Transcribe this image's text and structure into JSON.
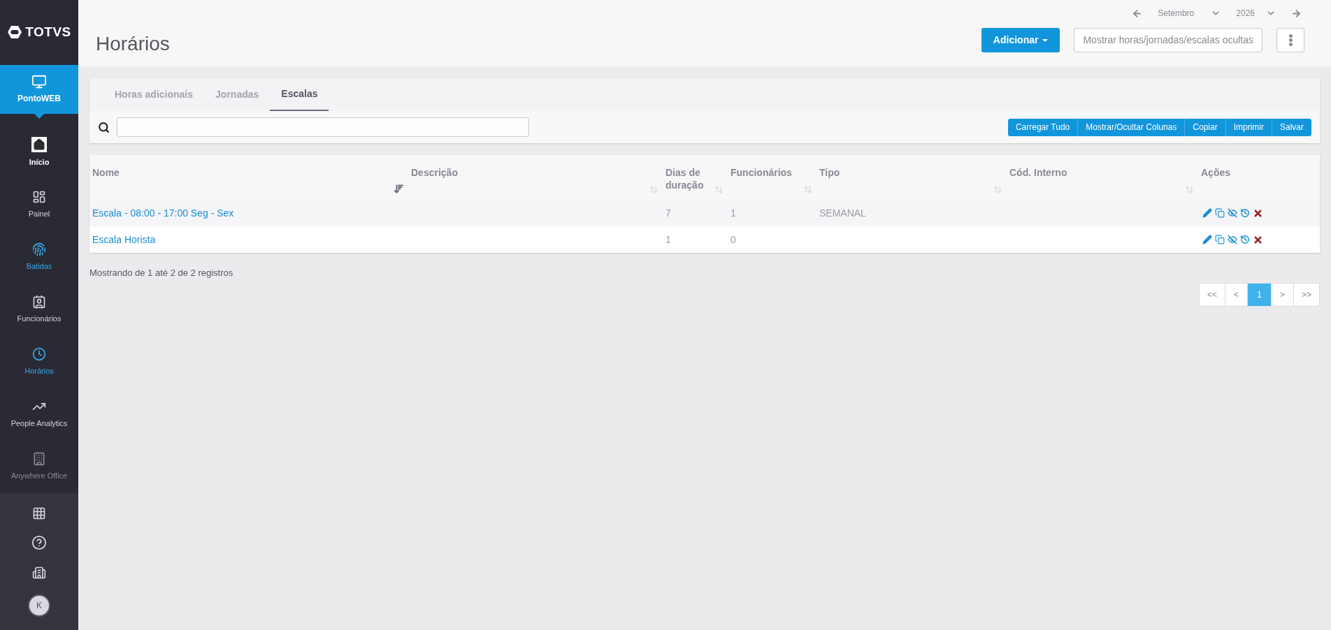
{
  "sidebar": {
    "logo": "TOTVS",
    "product": "PontoWEB",
    "items": [
      {
        "label": "Início",
        "selected": true,
        "color": "#ffffff"
      },
      {
        "label": "Painel",
        "selected": false,
        "color": "#d4d4dc"
      },
      {
        "label": "Batidas",
        "selected": false,
        "color": "#3ba7e8"
      },
      {
        "label": "Funcionários",
        "selected": false,
        "color": "#d4d4dc"
      },
      {
        "label": "Horários",
        "selected": false,
        "color": "#3ba7e8"
      },
      {
        "label": "People Analytics",
        "selected": false,
        "color": "#d4d4dc"
      },
      {
        "label": "Anywhere Office",
        "selected": false,
        "color": "#8a8a96"
      }
    ],
    "avatar": "K"
  },
  "header": {
    "title": "Horários",
    "month": "Setembro",
    "year": "2026",
    "add_button": "Adicionar",
    "toggle_button": "Mostrar horas/jornadas/escalas ocultas"
  },
  "tabs": [
    {
      "label": "Horas adicionais",
      "selected": false
    },
    {
      "label": "Jornadas",
      "selected": false
    },
    {
      "label": "Escalas",
      "selected": true
    }
  ],
  "toolbar": {
    "buttons": [
      "Carregar Tudo",
      "Mostrar/Ocultar Colunas",
      "Copiar",
      "Imprimir",
      "Salvar"
    ]
  },
  "table": {
    "columns": [
      {
        "label": "Nome",
        "sorted": true
      },
      {
        "label": "Descrição",
        "sorted": false
      },
      {
        "label": "Dias de duração",
        "sorted": false
      },
      {
        "label": "Funcionários",
        "sorted": false
      },
      {
        "label": "Tipo",
        "sorted": false
      },
      {
        "label": "Cód. Interno",
        "sorted": false
      },
      {
        "label": "Ações"
      }
    ],
    "rows": [
      {
        "nome": "Escala - 08:00 - 17:00 Seg - Sex",
        "dias": "7",
        "funcionarios": "1",
        "tipo": "SEMANAL"
      },
      {
        "nome": "Escala Horista",
        "dias": "1",
        "funcionarios": "0"
      }
    ]
  },
  "info": "Mostrando de 1 até 2 de 2 registros",
  "pagination": [
    {
      "label": "<<",
      "selected": false
    },
    {
      "label": "<",
      "selected": false
    },
    {
      "label": "1",
      "selected": true
    },
    {
      "label": ">",
      "selected": false
    },
    {
      "label": ">>",
      "selected": false
    }
  ]
}
